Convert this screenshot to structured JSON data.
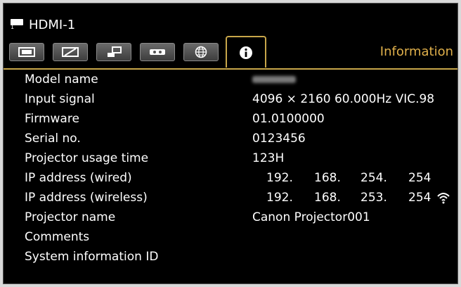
{
  "header": {
    "input_label": "HDMI-1",
    "icon_text": "1"
  },
  "tabs": [
    {
      "name": "image",
      "icon": "screen-icon",
      "active": false
    },
    {
      "name": "picture",
      "icon": "picture-adjust-icon",
      "active": false
    },
    {
      "name": "install",
      "icon": "install-icon",
      "active": false
    },
    {
      "name": "system",
      "icon": "projector-icon",
      "active": false
    },
    {
      "name": "network",
      "icon": "globe-icon",
      "active": false
    },
    {
      "name": "information",
      "icon": "info-icon",
      "active": true
    }
  ],
  "tab_title": "Information",
  "rows": [
    {
      "label": "Model name",
      "value": ""
    },
    {
      "label": "Input signal",
      "value": "4096 × 2160 60.000Hz VIC.98"
    },
    {
      "label": "Firmware",
      "value": "01.0100000"
    },
    {
      "label": "Serial no.",
      "value": "0123456"
    },
    {
      "label": "Projector usage time",
      "value": "123H"
    },
    {
      "label": "IP address (wired)",
      "ip": [
        "192.",
        "168.",
        "254.",
        "254"
      ]
    },
    {
      "label": "IP address (wireless)",
      "ip": [
        "192.",
        "168.",
        "253.",
        "254"
      ]
    },
    {
      "label": "Projector name",
      "value": "Canon Projector001"
    },
    {
      "label": "Comments",
      "value": ""
    },
    {
      "label": "System information ID",
      "value": ""
    }
  ],
  "colors": {
    "accent": "#c8a64a",
    "tab_title": "#e0b04b",
    "background": "#000000",
    "text": "#ffffff"
  }
}
